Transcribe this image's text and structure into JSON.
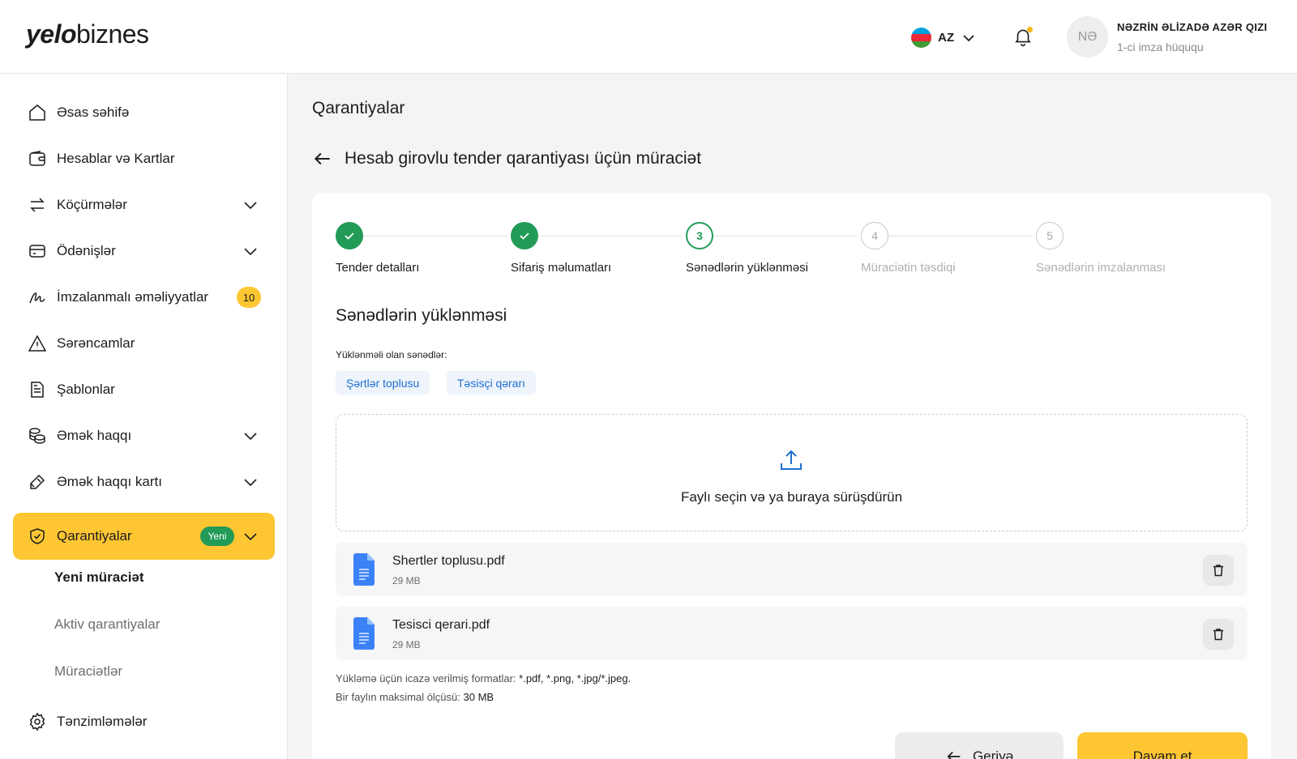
{
  "brand": {
    "logo_bold": "yelo",
    "logo_light": "biznes"
  },
  "header": {
    "language": "AZ",
    "user_initials": "NƏ",
    "user_name": "NƏZRİN ƏLİZADƏ AZƏR QIZI",
    "user_role": "1-ci imza hüququ"
  },
  "sidebar": {
    "items": [
      {
        "label": "Əsas səhifə",
        "icon": "home-icon"
      },
      {
        "label": "Hesablar və Kartlar",
        "icon": "wallet-icon"
      },
      {
        "label": "Köçürmələr",
        "icon": "transfer-icon",
        "expandable": true
      },
      {
        "label": "Ödənişlər",
        "icon": "card-icon",
        "expandable": true
      },
      {
        "label": "İmzalanmalı əməliyyatlar",
        "icon": "signature-icon",
        "badge": "10"
      },
      {
        "label": "Sərəncamlar",
        "icon": "warning-icon"
      },
      {
        "label": "Şablonlar",
        "icon": "document-icon"
      },
      {
        "label": "Əmək haqqı",
        "icon": "coins-icon",
        "expandable": true
      },
      {
        "label": "Əmək haqqı kartı",
        "icon": "card-edit-icon",
        "expandable": true
      },
      {
        "label": "Qarantiyalar",
        "icon": "shield-check-icon",
        "badge": "Yeni",
        "expandable": true,
        "active": true
      },
      {
        "label": "Tənzimləmələr",
        "icon": "gear-icon"
      }
    ],
    "sub_items": [
      "Yeni müraciət",
      "Aktiv qarantiyalar",
      "Müraciətlər"
    ]
  },
  "main": {
    "page_title": "Qarantiyalar",
    "form_title": "Hesab girovlu tender qarantiyası üçün müraciət",
    "steps": [
      {
        "num": "1",
        "label": "Tender detalları",
        "state": "done"
      },
      {
        "num": "2",
        "label": "Sifariş məlumatları",
        "state": "done"
      },
      {
        "num": "3",
        "label": "Sənədlərin yüklənməsi",
        "state": "current"
      },
      {
        "num": "4",
        "label": "Müraciətin təsdiqi",
        "state": "pending"
      },
      {
        "num": "5",
        "label": "Sənədlərin imzalanması",
        "state": "pending"
      }
    ],
    "section_title": "Sənədlərin yüklənməsi",
    "required_label": "Yüklənməli olan sənədlər:",
    "required_docs": [
      "Şərtlər toplusu",
      "Təsisçi qərarı"
    ],
    "dropzone_text": "Faylı seçin və ya buraya sürüşdürün",
    "files": [
      {
        "name": "Shertler toplusu.pdf",
        "size": "29 MB"
      },
      {
        "name": "Tesisci qerari.pdf",
        "size": "29 MB"
      }
    ],
    "formats_label": "Yükləmə üçün icazə verilmiş formatlar:",
    "formats_value": "*.pdf, *.png, *.jpg/*.jpeg.",
    "max_size_label": "Bir faylın maksimal ölçüsü:",
    "max_size_value": "30 MB",
    "back_button": "Geriyə",
    "next_button": "Davam et"
  },
  "colors": {
    "accent": "#fdc632",
    "success": "#229b57",
    "link": "#1f6fd1"
  }
}
